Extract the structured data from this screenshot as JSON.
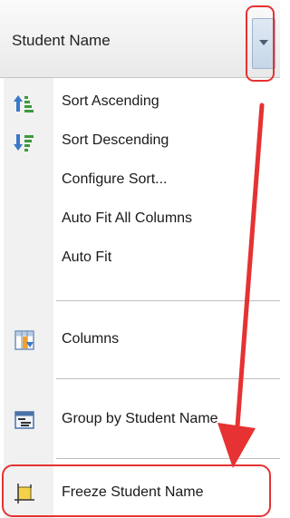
{
  "header": {
    "label": "Student Name",
    "dropdown_icon": "triangle-down-icon"
  },
  "menu": {
    "sort_ascending": "Sort Ascending",
    "sort_descending": "Sort Descending",
    "configure_sort": "Configure Sort...",
    "auto_fit_all": "Auto Fit All Columns",
    "auto_fit": "Auto Fit",
    "columns": "Columns",
    "group_by": "Group by Student Name",
    "freeze": "Freeze Student Name"
  },
  "icons": {
    "sort_ascending": "sort-ascending-icon",
    "sort_descending": "sort-descending-icon",
    "columns": "columns-icon",
    "group_by": "group-by-icon",
    "freeze": "freeze-icon"
  },
  "colors": {
    "annotation": "#e63232",
    "menu_gutter": "#f1f1f1",
    "header_button": "#c6d6e8"
  }
}
